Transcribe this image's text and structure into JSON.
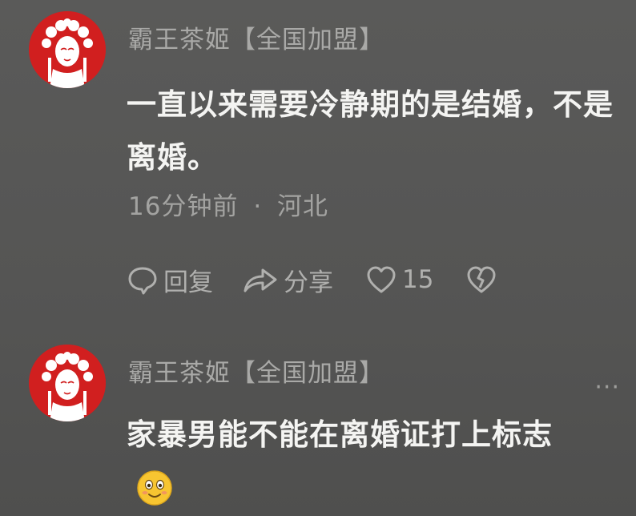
{
  "comments": [
    {
      "username": "霸王茶姬【全国加盟】",
      "avatar_icon": "opera-face-avatar",
      "text": "一直以来需要冷静期的是结婚，不是离婚。",
      "time": "16分钟前",
      "separator": "·",
      "location": "河北",
      "actions": {
        "reply_label": "回复",
        "share_label": "分享",
        "like_count": "15"
      }
    },
    {
      "username": "霸王茶姬【全国加盟】",
      "avatar_icon": "opera-face-avatar",
      "text": "家暴男能不能在离婚证打上标志",
      "emoji": "smiling-face-emoji",
      "more_label": "···"
    }
  ],
  "colors": {
    "background": "#565655",
    "avatar_red": "#d11f1f",
    "primary_text": "#f4f4f2",
    "secondary_text": "#a9a9a7"
  }
}
